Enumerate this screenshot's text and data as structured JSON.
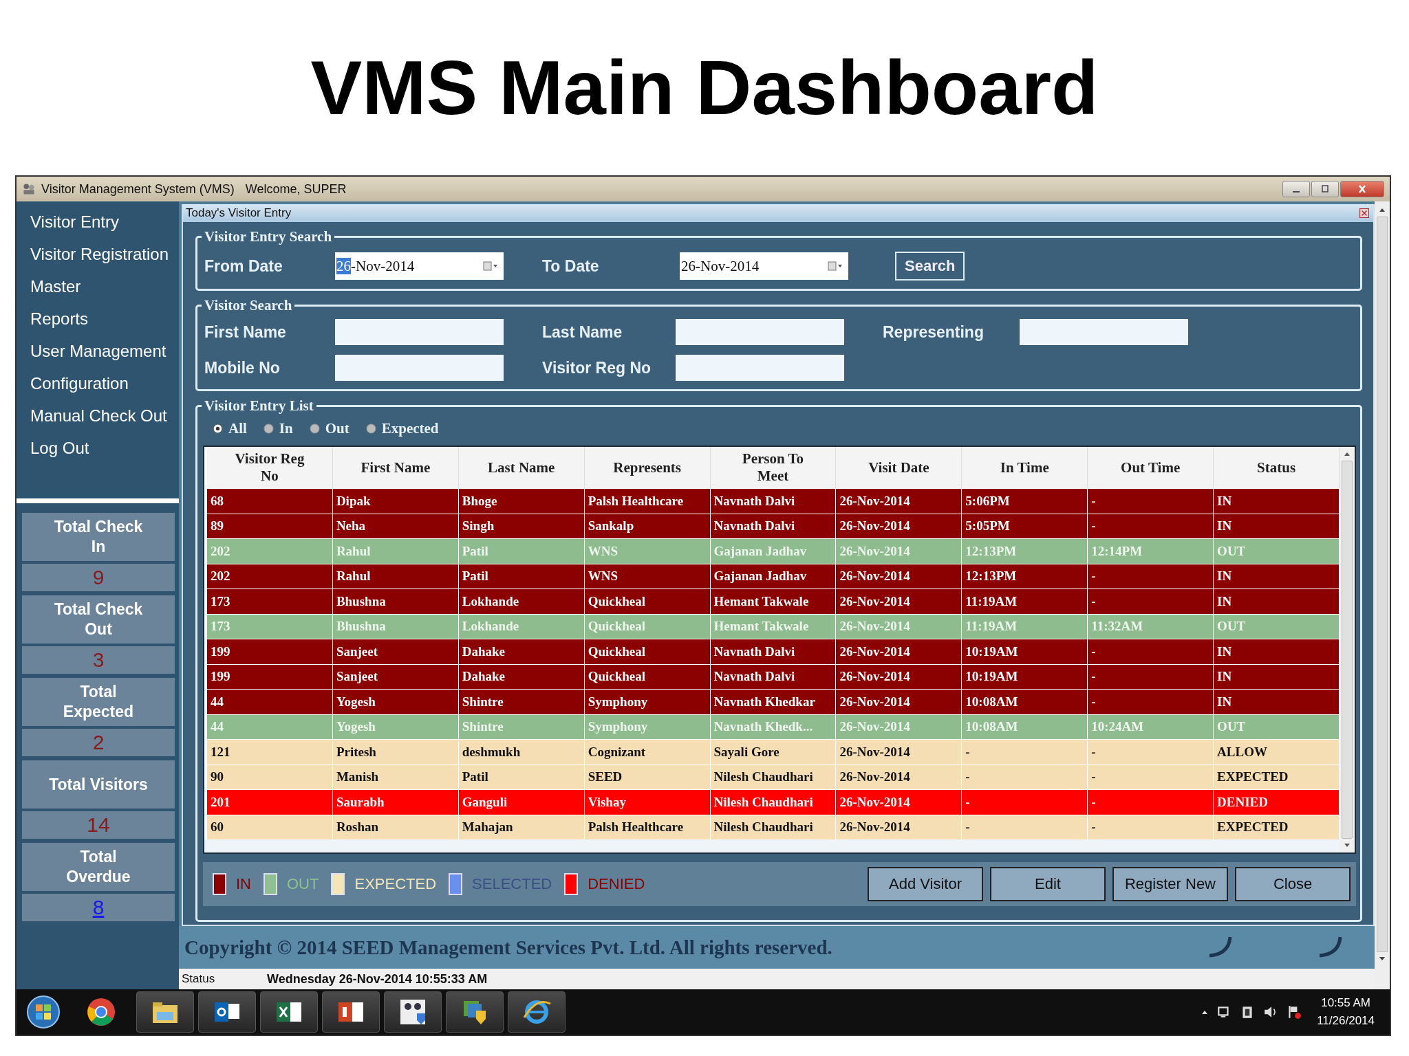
{
  "slide_title": "VMS Main Dashboard",
  "window": {
    "title": "Visitor Management System (VMS)",
    "welcome": "Welcome, SUPER"
  },
  "sidebar": {
    "items": [
      "Visitor Entry",
      "Visitor Registration",
      "Master",
      "Reports",
      "User Management",
      "Configuration",
      "Manual Check Out",
      "Log Out"
    ],
    "stats": [
      {
        "label": "Total Check In",
        "value": "9",
        "kind": "count"
      },
      {
        "label": "Total Check Out",
        "value": "3",
        "kind": "count"
      },
      {
        "label": "Total Expected",
        "value": "2",
        "kind": "count"
      },
      {
        "label": "Total Visitors",
        "value": "14",
        "kind": "count"
      },
      {
        "label": "Total Overdue",
        "value": "8",
        "kind": "link"
      }
    ]
  },
  "panel": {
    "title": "Today's Visitor Entry"
  },
  "entry_search": {
    "legend": "Visitor Entry Search",
    "from_label": "From Date",
    "from_selected": "26",
    "from_rest": "-Nov-2014",
    "to_label": "To Date",
    "to_value": "26-Nov-2014",
    "button": "Search"
  },
  "visitor_search": {
    "legend": "Visitor Search",
    "fields": [
      "First Name",
      "Last Name",
      "Representing",
      "Mobile No",
      "Visitor Reg No"
    ]
  },
  "entry_list": {
    "legend": "Visitor Entry List",
    "filters": [
      {
        "label": "All",
        "selected": true
      },
      {
        "label": "In",
        "selected": false
      },
      {
        "label": "Out",
        "selected": false
      },
      {
        "label": "Expected",
        "selected": false
      }
    ],
    "columns": [
      "Visitor Reg No",
      "First Name",
      "Last Name",
      "Represents",
      "Person To Meet",
      "Visit Date",
      "In Time",
      "Out Time",
      "Status"
    ],
    "rows": [
      {
        "kind": "in",
        "cells": [
          "68",
          "Dipak",
          "Bhoge",
          "Palsh Healthcare",
          "Navnath Dalvi",
          "26-Nov-2014",
          "5:06PM",
          "-",
          "IN"
        ]
      },
      {
        "kind": "in",
        "cells": [
          "89",
          "Neha",
          "Singh",
          "Sankalp",
          "Navnath Dalvi",
          "26-Nov-2014",
          "5:05PM",
          "-",
          "IN"
        ]
      },
      {
        "kind": "out",
        "cells": [
          "202",
          "Rahul",
          "Patil",
          "WNS",
          "Gajanan Jadhav",
          "26-Nov-2014",
          "12:13PM",
          "12:14PM",
          "OUT"
        ]
      },
      {
        "kind": "in",
        "cells": [
          "202",
          "Rahul",
          "Patil",
          "WNS",
          "Gajanan Jadhav",
          "26-Nov-2014",
          "12:13PM",
          "-",
          "IN"
        ]
      },
      {
        "kind": "in",
        "cells": [
          "173",
          "Bhushna",
          "Lokhande",
          "Quickheal",
          "Hemant Takwale",
          "26-Nov-2014",
          "11:19AM",
          "-",
          "IN"
        ]
      },
      {
        "kind": "out",
        "cells": [
          "173",
          "Bhushna",
          "Lokhande",
          "Quickheal",
          "Hemant Takwale",
          "26-Nov-2014",
          "11:19AM",
          "11:32AM",
          "OUT"
        ]
      },
      {
        "kind": "in",
        "cells": [
          "199",
          "Sanjeet",
          "Dahake",
          "Quickheal",
          "Navnath Dalvi",
          "26-Nov-2014",
          "10:19AM",
          "-",
          "IN"
        ]
      },
      {
        "kind": "in",
        "cells": [
          "199",
          "Sanjeet",
          "Dahake",
          "Quickheal",
          "Navnath Dalvi",
          "26-Nov-2014",
          "10:19AM",
          "-",
          "IN"
        ]
      },
      {
        "kind": "in",
        "cells": [
          "44",
          "Yogesh",
          "Shintre",
          "Symphony",
          "Navnath Khedkar",
          "26-Nov-2014",
          "10:08AM",
          "-",
          "IN"
        ]
      },
      {
        "kind": "out",
        "cells": [
          "44",
          "Yogesh",
          "Shintre",
          "Symphony",
          "Navnath Khedk...",
          "26-Nov-2014",
          "10:08AM",
          "10:24AM",
          "OUT"
        ]
      },
      {
        "kind": "expected",
        "cells": [
          "121",
          "Pritesh",
          "deshmukh",
          "Cognizant",
          "Sayali Gore",
          "26-Nov-2014",
          "-",
          "-",
          "ALLOW"
        ]
      },
      {
        "kind": "expected",
        "cells": [
          "90",
          "Manish",
          "Patil",
          "SEED",
          "Nilesh Chaudhari",
          "26-Nov-2014",
          "-",
          "-",
          "EXPECTED"
        ]
      },
      {
        "kind": "denied",
        "cells": [
          "201",
          "Saurabh",
          "Ganguli",
          "Vishay",
          "Nilesh Chaudhari",
          "26-Nov-2014",
          "-",
          "-",
          "DENIED"
        ]
      },
      {
        "kind": "expected",
        "cells": [
          "60",
          "Roshan",
          "Mahajan",
          "Palsh Healthcare",
          "Nilesh Chaudhari",
          "26-Nov-2014",
          "-",
          "-",
          "EXPECTED"
        ]
      }
    ],
    "legend_items": [
      {
        "label": "IN",
        "color": "#8b0000"
      },
      {
        "label": "OUT",
        "color": "#90c090"
      },
      {
        "label": "EXPECTED",
        "color": "#f5e6b8"
      },
      {
        "label": "SELECTED",
        "color": "#6b8fef"
      },
      {
        "label": "DENIED",
        "color": "#ff0000"
      }
    ],
    "buttons": [
      "Add Visitor",
      "Edit",
      "Register New",
      "Close"
    ]
  },
  "copyright": "Copyright © 2014 SEED Management Services Pvt. Ltd. All rights reserved.",
  "status_bar": {
    "label": "Status",
    "text": "Wednesday 26-Nov-2014 10:55:33 AM"
  },
  "taskbar": {
    "time": "10:55 AM",
    "date": "11/26/2014"
  }
}
